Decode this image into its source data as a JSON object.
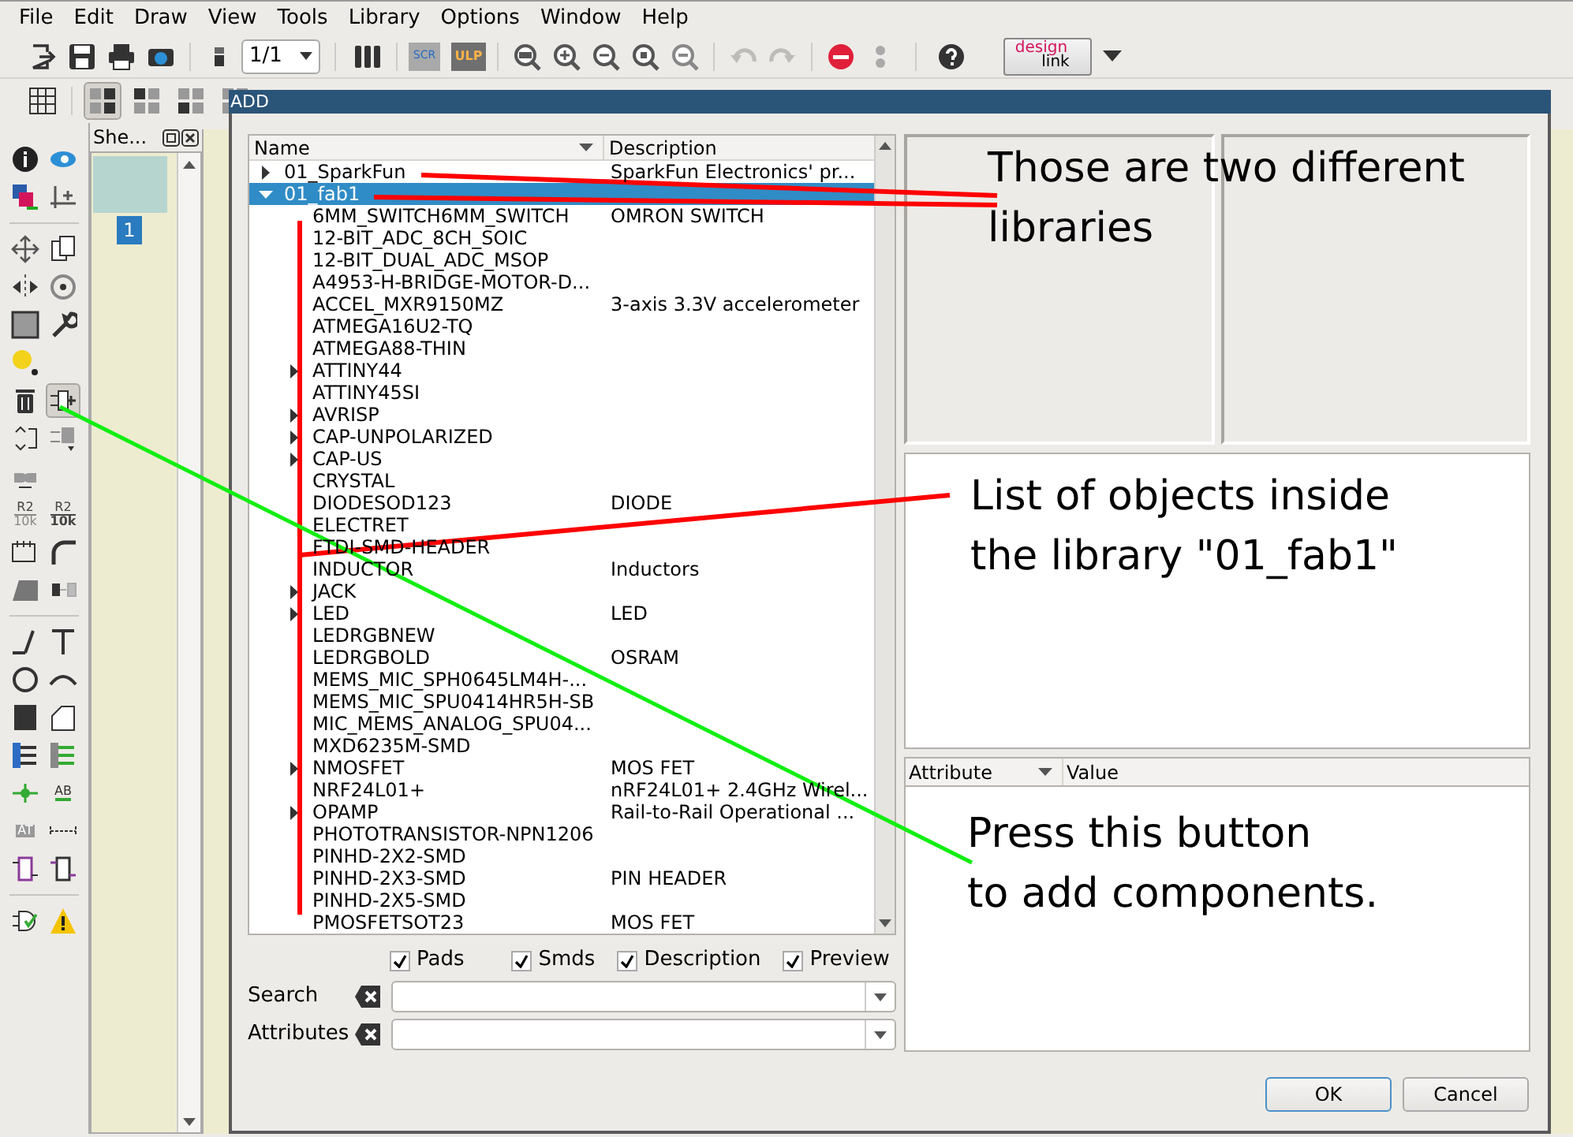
{
  "menu": [
    "File",
    "Edit",
    "Draw",
    "View",
    "Tools",
    "Library",
    "Options",
    "Window",
    "Help"
  ],
  "toolbar": {
    "sheet_combo": "1/1",
    "script_label": "SCR",
    "ulp_label": "ULP",
    "undo_disabled": true,
    "redo_disabled": true,
    "logo_top": "design",
    "logo_bottom": "link"
  },
  "layout_buttons": [
    {
      "selected": true
    },
    {
      "selected": false
    },
    {
      "selected": false
    },
    {
      "selected": false
    }
  ],
  "tool_palette": [
    {
      "selected": false
    },
    {
      "selected": false
    },
    {
      "selected": false
    },
    {
      "selected": false
    },
    {
      "selected": false
    },
    {
      "selected": false
    },
    {
      "selected": false
    },
    {
      "selected": false
    },
    {
      "selected": false
    },
    {
      "selected": false
    },
    {
      "selected": false
    },
    {
      "selected": false
    },
    {
      "selected": true
    },
    {
      "selected": false
    },
    {
      "selected": false
    },
    {
      "selected": false
    },
    {
      "selected": false,
      "label": "R2",
      "sublabel": "10k"
    },
    {
      "selected": false,
      "label": "R2",
      "sublabel": "10k"
    },
    {
      "selected": false
    },
    {
      "selected": false
    },
    {
      "selected": false
    },
    {
      "selected": false
    },
    {
      "selected": false
    },
    {
      "selected": false
    },
    {
      "selected": false
    },
    {
      "selected": false
    },
    {
      "selected": false
    },
    {
      "selected": false
    },
    {
      "selected": false
    },
    {
      "selected": false
    },
    {
      "selected": false
    },
    {
      "selected": false,
      "label": "AB"
    },
    {
      "selected": false,
      "label": "AT"
    },
    {
      "selected": false
    },
    {
      "selected": false
    },
    {
      "selected": false
    },
    {
      "selected": false
    },
    {
      "selected": false
    }
  ],
  "sheets_panel": {
    "title": "She...",
    "sheets": [
      {
        "number": "1",
        "selected": true
      }
    ]
  },
  "dialog": {
    "title": "ADD",
    "tree": {
      "columns": [
        "Name",
        "Description"
      ],
      "rows": [
        {
          "name": "01_SparkFun",
          "description": "SparkFun Electronics' pr...",
          "expanded": false,
          "selected": false
        },
        {
          "name": "01_fab1",
          "expanded": true,
          "selected": true,
          "children": [
            {
              "name": "6MM_SWITCH6MM_SWITCH",
              "description": "OMRON SWITCH"
            },
            {
              "name": "12-BIT_ADC_8CH_SOIC"
            },
            {
              "name": "12-BIT_DUAL_ADC_MSOP"
            },
            {
              "name": "A4953-H-BRIDGE-MOTOR-D..."
            },
            {
              "name": "ACCEL_MXR9150MZ",
              "description": "3-axis 3.3V accelerometer"
            },
            {
              "name": "ATMEGA16U2-TQ"
            },
            {
              "name": "ATMEGA88-THIN"
            },
            {
              "name": "ATTINY44",
              "expanded": false
            },
            {
              "name": "ATTINY45SI"
            },
            {
              "name": "AVRISP",
              "expanded": false
            },
            {
              "name": "CAP-UNPOLARIZED",
              "expanded": false
            },
            {
              "name": "CAP-US",
              "expanded": false
            },
            {
              "name": "CRYSTAL"
            },
            {
              "name": "DIODESOD123",
              "description": "DIODE"
            },
            {
              "name": "ELECTRET"
            },
            {
              "name": "FTDI-SMD-HEADER"
            },
            {
              "name": "INDUCTOR",
              "description": "Inductors"
            },
            {
              "name": "JACK",
              "expanded": false
            },
            {
              "name": "LED",
              "description": "LED",
              "expanded": false
            },
            {
              "name": "LEDRGBNEW"
            },
            {
              "name": "LEDRGBOLD",
              "description": "OSRAM"
            },
            {
              "name": "MEMS_MIC_SPH0645LM4H-..."
            },
            {
              "name": "MEMS_MIC_SPU0414HR5H-SB"
            },
            {
              "name": "MIC_MEMS_ANALOG_SPU04..."
            },
            {
              "name": "MXD6235M-SMD"
            },
            {
              "name": "NMOSFET",
              "description": "MOS FET",
              "expanded": false
            },
            {
              "name": "NRF24L01+",
              "description": "nRF24L01+ 2.4GHz Wirel..."
            },
            {
              "name": "OPAMP",
              "description": "Rail-to-Rail Operational ...",
              "expanded": false
            },
            {
              "name": "PHOTOTRANSISTOR-NPN1206"
            },
            {
              "name": "PINHD-2X2-SMD"
            },
            {
              "name": "PINHD-2X3-SMD",
              "description": "PIN HEADER"
            },
            {
              "name": "PINHD-2X5-SMD"
            },
            {
              "name": "PMOSFETSOT23",
              "description": "MOS FET"
            }
          ]
        }
      ]
    },
    "options": [
      {
        "label": "Pads",
        "checked": true
      },
      {
        "label": "Smds",
        "checked": true
      },
      {
        "label": "Description",
        "checked": true
      },
      {
        "label": "Preview",
        "checked": true
      }
    ],
    "search_label": "Search",
    "attributes_label": "Attributes",
    "attribute_table": {
      "columns": [
        "Attribute",
        "Value"
      ]
    },
    "buttons": [
      "OK",
      "Cancel"
    ]
  },
  "annotations": [
    {
      "lines": [
        "Those are two different",
        "libraries"
      ]
    },
    {
      "lines": [
        "List of objects inside",
        "the library \"01_fab1\""
      ]
    },
    {
      "lines": [
        "Press this button",
        "to add components."
      ]
    }
  ]
}
